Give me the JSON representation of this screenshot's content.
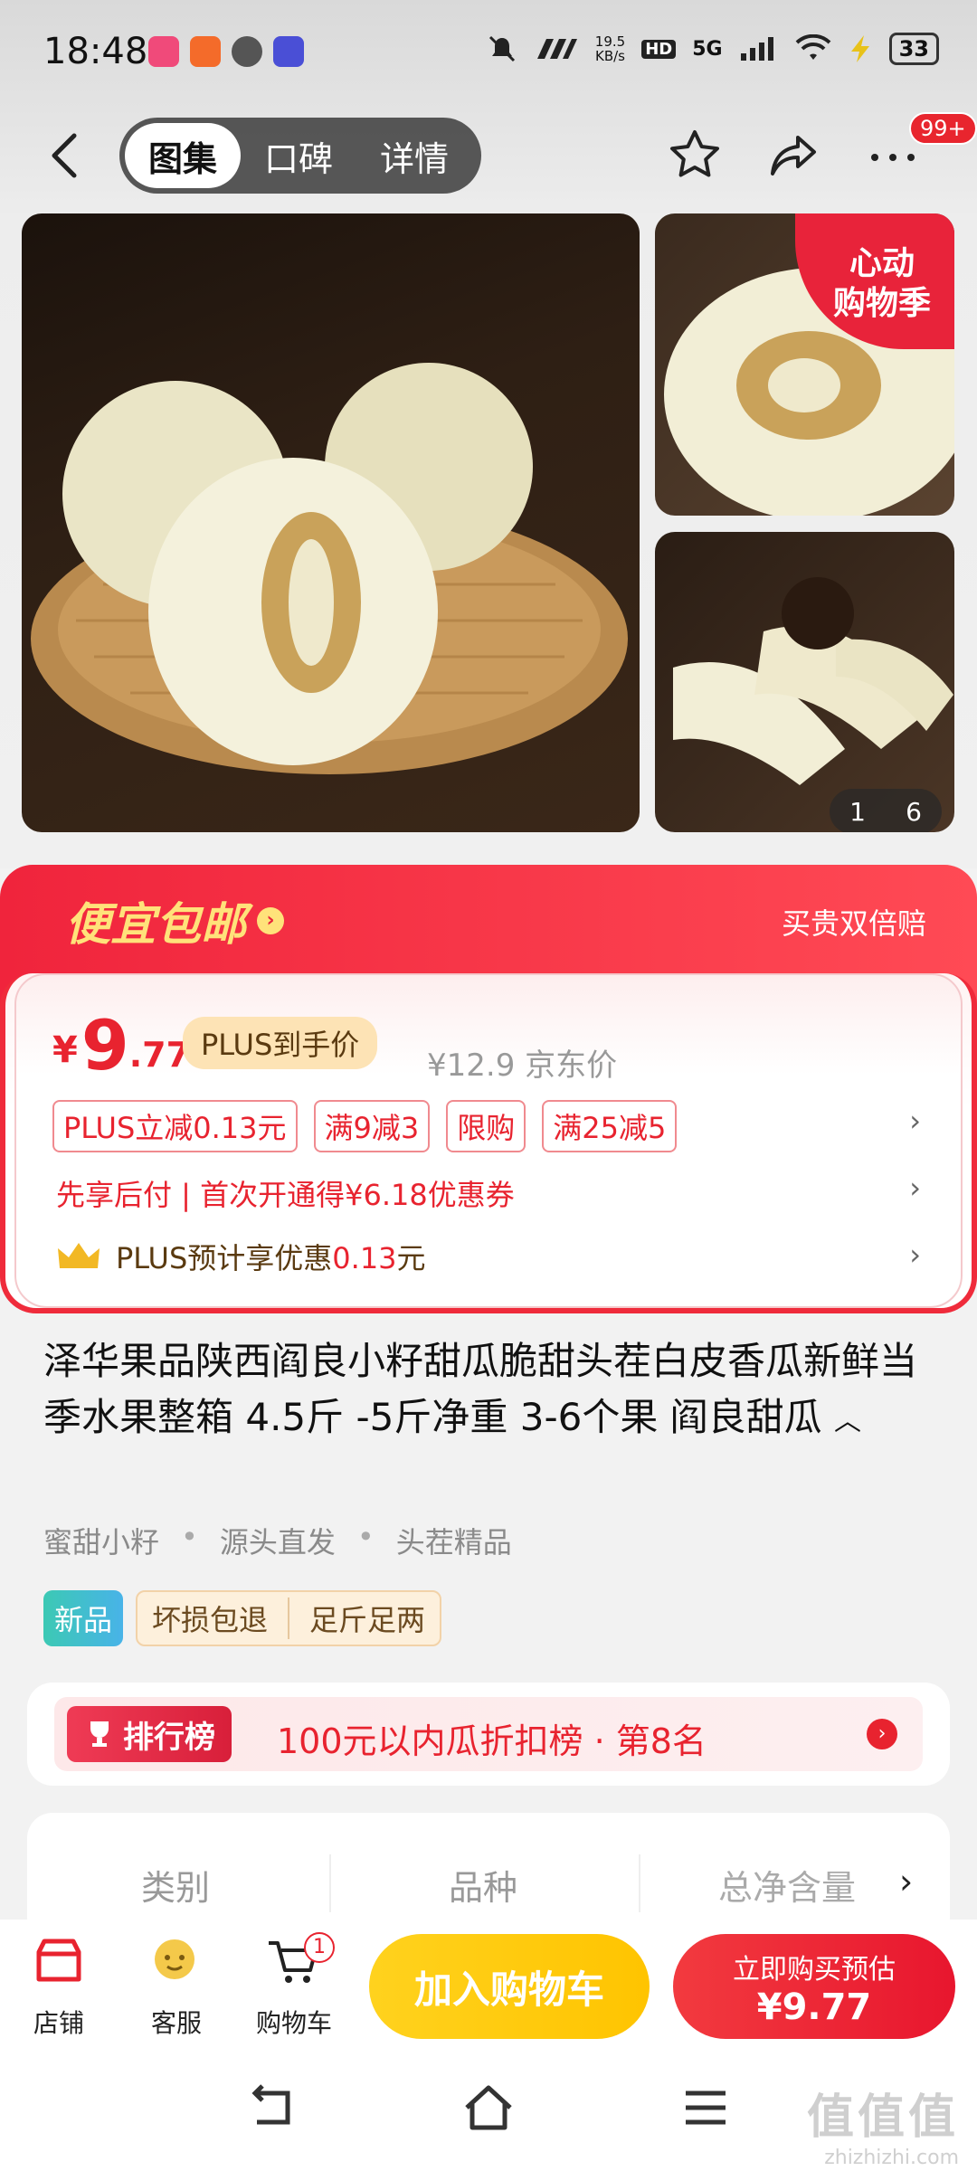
{
  "status_bar": {
    "time": "18:48",
    "net_speed_value": "19.5",
    "net_speed_unit": "KB/s",
    "hd": "HD",
    "signal": "5G",
    "battery": "33"
  },
  "nav": {
    "tabs": [
      {
        "label": "图集",
        "active": true
      },
      {
        "label": "口碑",
        "active": false
      },
      {
        "label": "详情",
        "active": false
      }
    ],
    "more_badge": "99+"
  },
  "gallery": {
    "promo_corner_line1": "心动",
    "promo_corner_line2": "购物季",
    "counter_current": "1",
    "counter_total": "6"
  },
  "promo": {
    "label": "便宜包邮",
    "guarantee": "买贵双倍赔"
  },
  "price": {
    "currency": "¥",
    "integer": "9",
    "decimal": ".77",
    "plus_label": "PLUS到手价",
    "jd_price": "¥12.9 京东价",
    "coupons": [
      "PLUS立减0.13元",
      "满9减3",
      "限购",
      "满25减5"
    ],
    "pay_later": "先享后付 | 首次开通得¥6.18优惠券",
    "plus_estimate_prefix": "PLUS预计享优惠",
    "plus_estimate_value": "0.13",
    "plus_estimate_suffix": "元"
  },
  "product": {
    "title": "泽华果品陕西阎良小籽甜瓜脆甜头茬白皮香瓜新鲜当季水果整箱 4.5斤 -5斤净重 3-6个果 阎良甜瓜",
    "tags": [
      "蜜甜小籽",
      "源头直发",
      "头茬精品"
    ],
    "new_badge": "新品",
    "services": [
      "坏损包退",
      "足斤足两"
    ]
  },
  "ranking": {
    "tag": "排行榜",
    "text": "100元以内瓜折扣榜 · 第8名"
  },
  "specs": {
    "columns": [
      "类别",
      "品种",
      "总净含量"
    ]
  },
  "bottom_bar": {
    "shop": "店铺",
    "service": "客服",
    "cart": "购物车",
    "cart_count": "1",
    "add_to_cart": "加入购物车",
    "buy_now_line1": "立即购买预估",
    "buy_now_line2": "¥9.77"
  },
  "watermark": {
    "brand": "值值值",
    "url": "zhizhizhi.com"
  },
  "colors": {
    "accent_red": "#e8232f",
    "promo_yellow": "#ffe27a",
    "cart_yellow": "#ffc400"
  }
}
